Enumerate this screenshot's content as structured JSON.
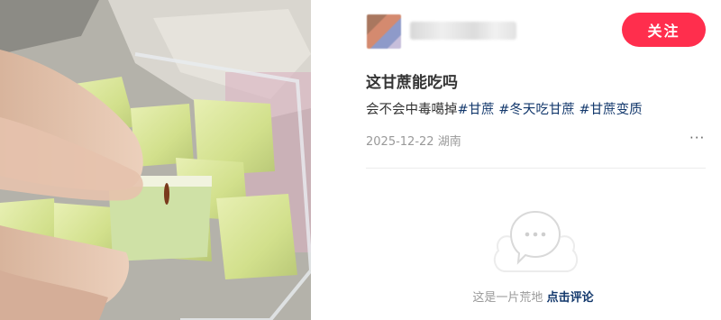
{
  "post": {
    "title": "这甘蔗能吃吗",
    "desc_text": "会不会中毒噶掉",
    "tags": [
      "#甘蔗",
      "#冬天吃甘蔗",
      "#甘蔗变质"
    ],
    "date": "2025-12-22",
    "location": "湖南",
    "more_label": "···"
  },
  "author": {
    "follow_label": "关注"
  },
  "comments": {
    "empty_text": "这是一片荒地",
    "cta": "点击评论"
  },
  "colors": {
    "accent": "#ff2e4d",
    "tag": "#13386c"
  },
  "icons": {
    "empty": "empty-comments-bubble-icon",
    "more": "more-dots-icon"
  }
}
